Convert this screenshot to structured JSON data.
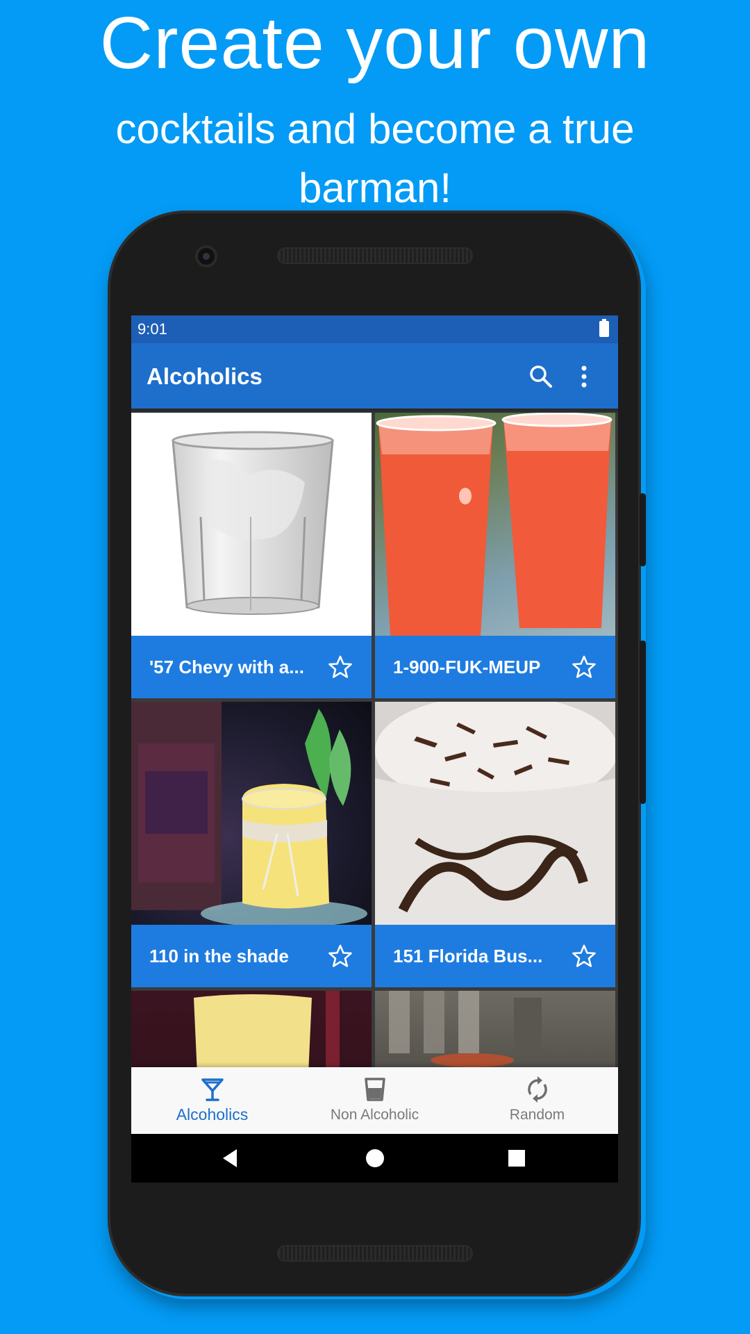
{
  "promo": {
    "headline": "Create your own",
    "subheadline": "cocktails and become a true barman!"
  },
  "status_bar": {
    "time": "9:01",
    "battery_icon": "battery-full-icon"
  },
  "app_bar": {
    "title": "Alcoholics",
    "search_icon": "search-icon",
    "more_icon": "more-vert-icon"
  },
  "cocktails": [
    {
      "name": "'57 Chevy with a...",
      "favorite_icon": "star-outline-icon",
      "photo": "clear glass of ice on white background"
    },
    {
      "name": "1-900-FUK-MEUP",
      "favorite_icon": "star-outline-icon",
      "photo": "two plastic cups of red drink"
    },
    {
      "name": "110 in the shade",
      "favorite_icon": "star-outline-icon",
      "photo": "yellow drink in jar with mint"
    },
    {
      "name": "151 Florida Bus...",
      "favorite_icon": "star-outline-icon",
      "photo": "milkshake with chocolate shavings"
    }
  ],
  "bottom_nav": {
    "items": [
      {
        "label": "Alcoholics",
        "icon": "cocktail-glass-icon",
        "active": true
      },
      {
        "label": "Non Alcoholic",
        "icon": "tumbler-glass-icon",
        "active": false
      },
      {
        "label": "Random",
        "icon": "refresh-icon",
        "active": false
      }
    ]
  },
  "system_nav": {
    "back_icon": "back-triangle-icon",
    "home_icon": "home-circle-icon",
    "recents_icon": "recents-square-icon"
  },
  "colors": {
    "background": "#039BF6",
    "status_bar": "#1D5FB6",
    "app_bar": "#1E6FCC",
    "caption": "#1E7CE0",
    "nav_active": "#1E6FCC"
  }
}
